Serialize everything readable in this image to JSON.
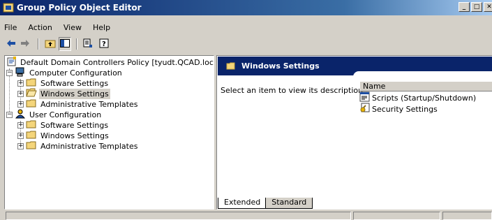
{
  "window": {
    "title": "Group Policy Object Editor"
  },
  "menubar": {
    "items": [
      "File",
      "Action",
      "View",
      "Help"
    ]
  },
  "toolbar": {
    "buttons": [
      "back-arrow-icon",
      "forward-arrow-icon",
      "up-folder-icon",
      "show-hide-tree-icon",
      "export-list-icon",
      "help-icon"
    ]
  },
  "tree": {
    "root": "Default Domain Controllers Policy [tyudt.QCAD.local] Policy",
    "computer": {
      "label": "Computer Configuration",
      "children": [
        "Software Settings",
        "Windows Settings",
        "Administrative Templates"
      ]
    },
    "user": {
      "label": "User Configuration",
      "children": [
        "Software Settings",
        "Windows Settings",
        "Administrative Templates"
      ]
    },
    "selected": "Windows Settings"
  },
  "detail": {
    "header": "Windows Settings",
    "description": "Select an item to view its description.",
    "column_name": "Name",
    "items": [
      "Scripts (Startup/Shutdown)",
      "Security Settings"
    ]
  },
  "tabs": [
    "Extended",
    "Standard"
  ],
  "colors": {
    "titlebar": "#0a246a",
    "face": "#d4d0c8",
    "folder": "#f4d57a"
  }
}
